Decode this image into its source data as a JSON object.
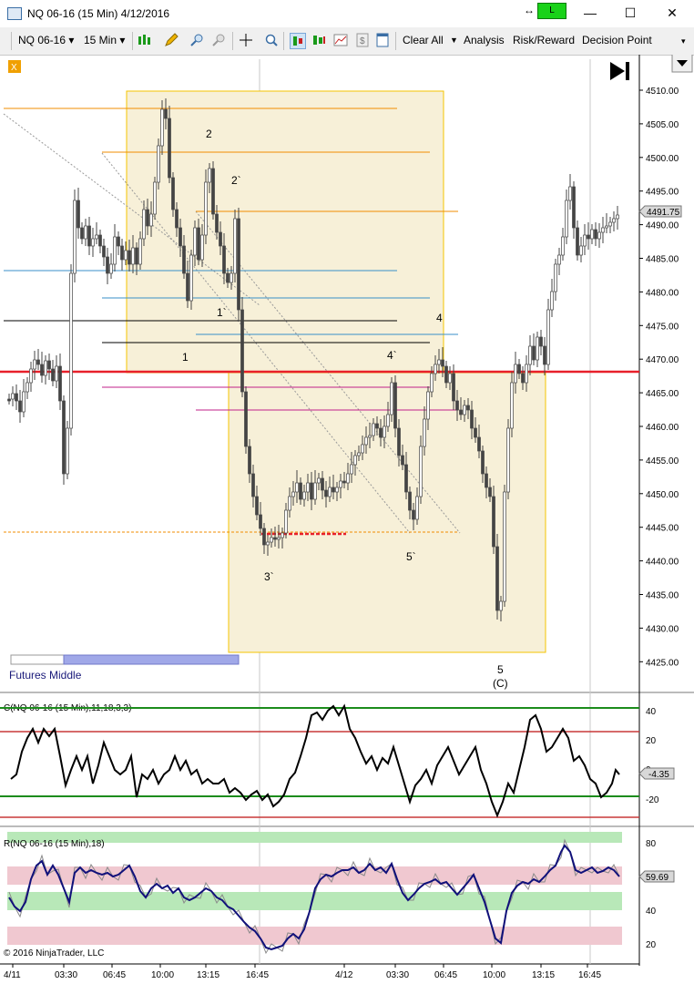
{
  "window": {
    "title": "NQ 06-16 (15 Min)  4/12/2016",
    "connection_label": "L",
    "minimize": "—",
    "maximize": "☐",
    "close": "✕"
  },
  "toolbar": {
    "instrument": "NQ 06-16",
    "interval": "15 Min",
    "clear_all": "Clear All",
    "analysis": "Analysis",
    "risk_reward": "Risk/Reward",
    "decision_point": "Decision Point"
  },
  "main_panel": {
    "price_ticks": [
      "4510.00",
      "4505.00",
      "4500.00",
      "4495.00",
      "4490.00",
      "4485.00",
      "4480.00",
      "4475.00",
      "4470.00",
      "4465.00",
      "4460.00",
      "4455.00",
      "4450.00",
      "4445.00",
      "4440.00",
      "4435.00",
      "4430.00",
      "4425.00"
    ],
    "last_price": "4491.75",
    "wave_labels": [
      "1",
      "2",
      "2`",
      "1`",
      "4",
      "4`",
      "5`",
      "3`",
      "5",
      "(C)"
    ],
    "futures_label": "Futures Middle",
    "x_marker": "X"
  },
  "cci_panel": {
    "title": "C(NQ 06-16 (15 Min),11,18,3,3)",
    "ticks": [
      "40",
      "20",
      "0",
      "-20"
    ],
    "value": "-4.35"
  },
  "rsi_panel": {
    "title": "R(NQ 06-16 (15 Min),18)",
    "ticks": [
      "80",
      "60",
      "40",
      "20"
    ],
    "value": "59.69"
  },
  "time_axis": {
    "ticks": [
      "4/11",
      "03:30",
      "06:45",
      "10:00",
      "13:15",
      "16:45",
      "4/12",
      "03:30",
      "06:45",
      "10:00",
      "13:15",
      "16:45"
    ]
  },
  "copyright": "© 2016 NinjaTrader, LLC",
  "colors": {
    "zone_fill": "#f7f0d8",
    "zone_border": "#f5c400",
    "red_line": "#e8202a",
    "orange_line": "#f08c00",
    "blue_line": "#3a8fc8",
    "magenta_line": "#c0208a",
    "cci_band_green": "#1c8c1c",
    "cci_band_red": "#c83838",
    "rsi_line": "#10107a"
  }
}
